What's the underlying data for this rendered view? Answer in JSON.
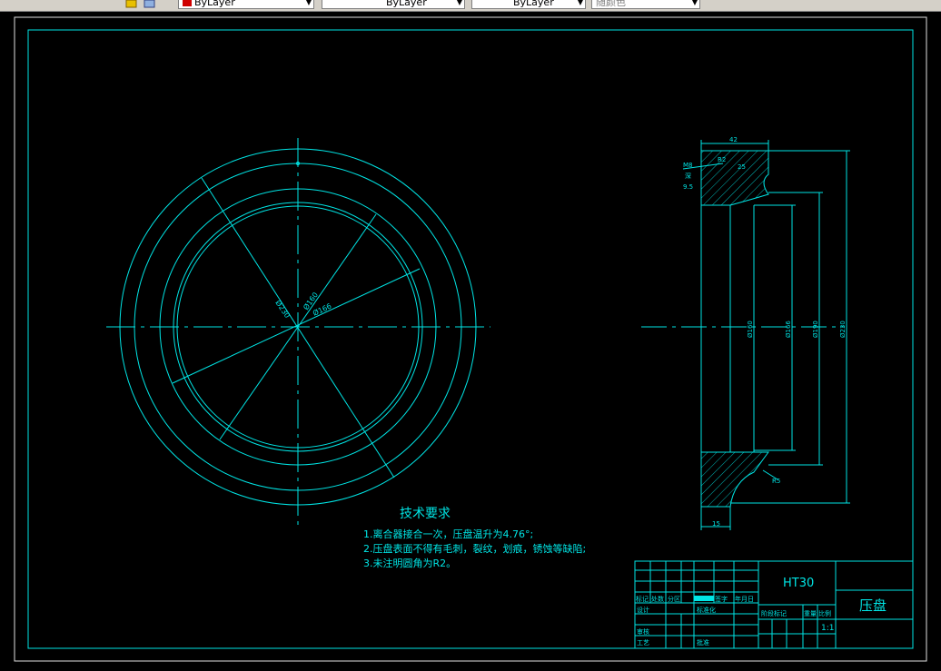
{
  "toolbar": {
    "layer_color": "ByLayer",
    "linetype": "ByLayer",
    "lineweight": "ByLayer",
    "plot_style": "随颜色"
  },
  "colors": {
    "line": "#00e5e5",
    "frame": "#00e5e5",
    "background": "#000000",
    "text": "#00e5e5"
  },
  "front_view": {
    "dims": {
      "d230": "Ø230",
      "d160": "Ø160",
      "d166": "Ø166"
    }
  },
  "section_view": {
    "dims": {
      "top_width": "42",
      "chamfer": "R2",
      "depth": "25",
      "thread": "M8",
      "deep_label": "深",
      "depth2": "9.5",
      "bottom_width": "15",
      "radius_lower": "R5",
      "d160": "Ø160",
      "d166": "Ø166",
      "d190": "Ø190",
      "d230": "Ø230"
    }
  },
  "tech_req": {
    "title": "技术要求",
    "items": [
      "1.离合器接合一次，压盘温升为4.76°;",
      "2.压盘表面不得有毛刺，裂纹，划痕，锈蚀等缺陷;",
      "3.未注明圆角为R2。"
    ]
  },
  "title_block": {
    "material": "HT30",
    "part_name": "压盘",
    "scale": "1:1",
    "labels": {
      "mark": "标记",
      "count": "处数",
      "zone": "分区",
      "change_doc": "更改文件号",
      "sign": "签字",
      "date": "年月日",
      "design": "设计",
      "standardize": "标准化",
      "stage_mark": "阶段标记",
      "weight": "重量",
      "scale_label": "比例",
      "review": "审核",
      "process": "工艺",
      "approve": "批准"
    }
  }
}
